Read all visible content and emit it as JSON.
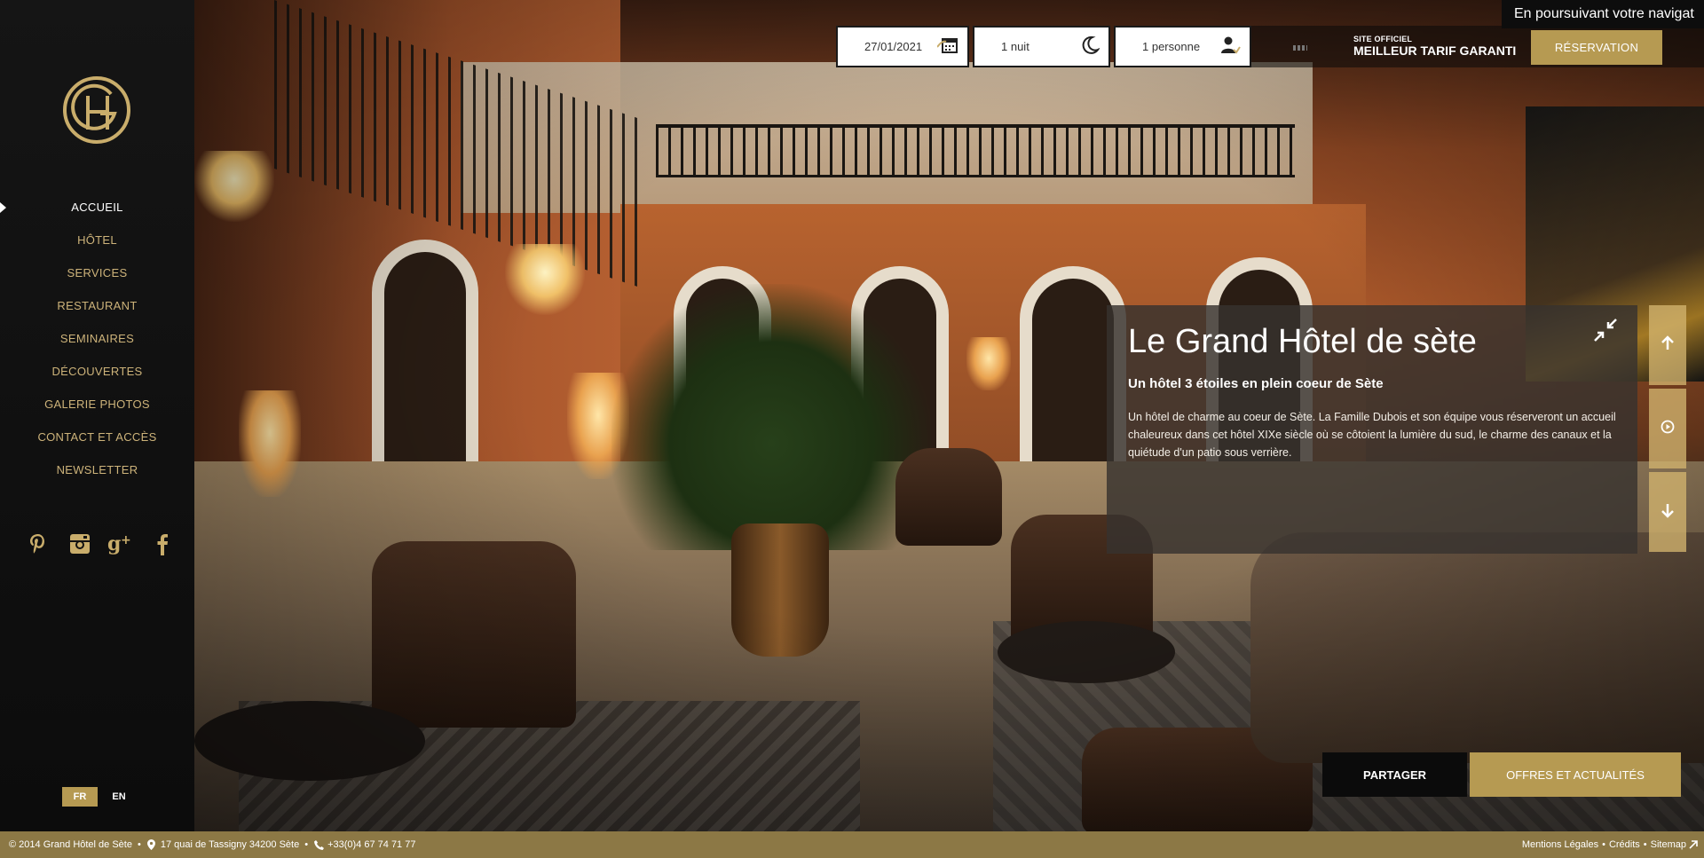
{
  "sidebar": {
    "logo_alt": "GH",
    "nav": [
      {
        "label": "ACCUEIL",
        "active": true
      },
      {
        "label": "HÔTEL"
      },
      {
        "label": "SERVICES"
      },
      {
        "label": "RESTAURANT"
      },
      {
        "label": "SEMINAIRES"
      },
      {
        "label": "DÉCOUVERTES"
      },
      {
        "label": "GALERIE PHOTOS"
      },
      {
        "label": "CONTACT ET ACCÈS"
      },
      {
        "label": "NEWSLETTER"
      }
    ],
    "social": [
      "pinterest-icon",
      "instagram-icon",
      "google-plus-icon",
      "facebook-icon"
    ],
    "lang": {
      "fr": "FR",
      "en": "EN",
      "active": "FR"
    }
  },
  "booking": {
    "date": "27/01/2021",
    "nights": "1 nuit",
    "persons": "1 personne"
  },
  "topbar": {
    "official_small": "SITE OFFICIEL",
    "official_large": "MEILLEUR TARIF GARANTI",
    "reservation": "RÉSERVATION",
    "cookie_text": "En poursuivant votre navigat"
  },
  "panel": {
    "title": "Le Grand Hôtel de sète",
    "subtitle": "Un hôtel 3 étoiles en plein coeur de Sète",
    "description": "Un hôtel de charme au coeur de Sète. La Famille Dubois et son équipe vous réserveront un accueil chaleureux dans cet hôtel XIXe siècle où se côtoient la lumière du sud, le charme des canaux et la quiétude d'un patio sous verrière."
  },
  "actions": {
    "share": "PARTAGER",
    "offers": "OFFRES ET ACTUALITÉS"
  },
  "footer": {
    "copyright": "© 2014  Grand Hôtel de Sète",
    "address": "17 quai de Tassigny 34200 Sète",
    "phone": "+33(0)4 67 74 71 77",
    "legal": "Mentions Légales",
    "credits": "Crédits",
    "sitemap": "Sitemap"
  },
  "colors": {
    "gold": "#b69a52",
    "footer": "#8c7845",
    "sidebar": "#0f0f0f",
    "nav_text": "#cdb37a"
  }
}
